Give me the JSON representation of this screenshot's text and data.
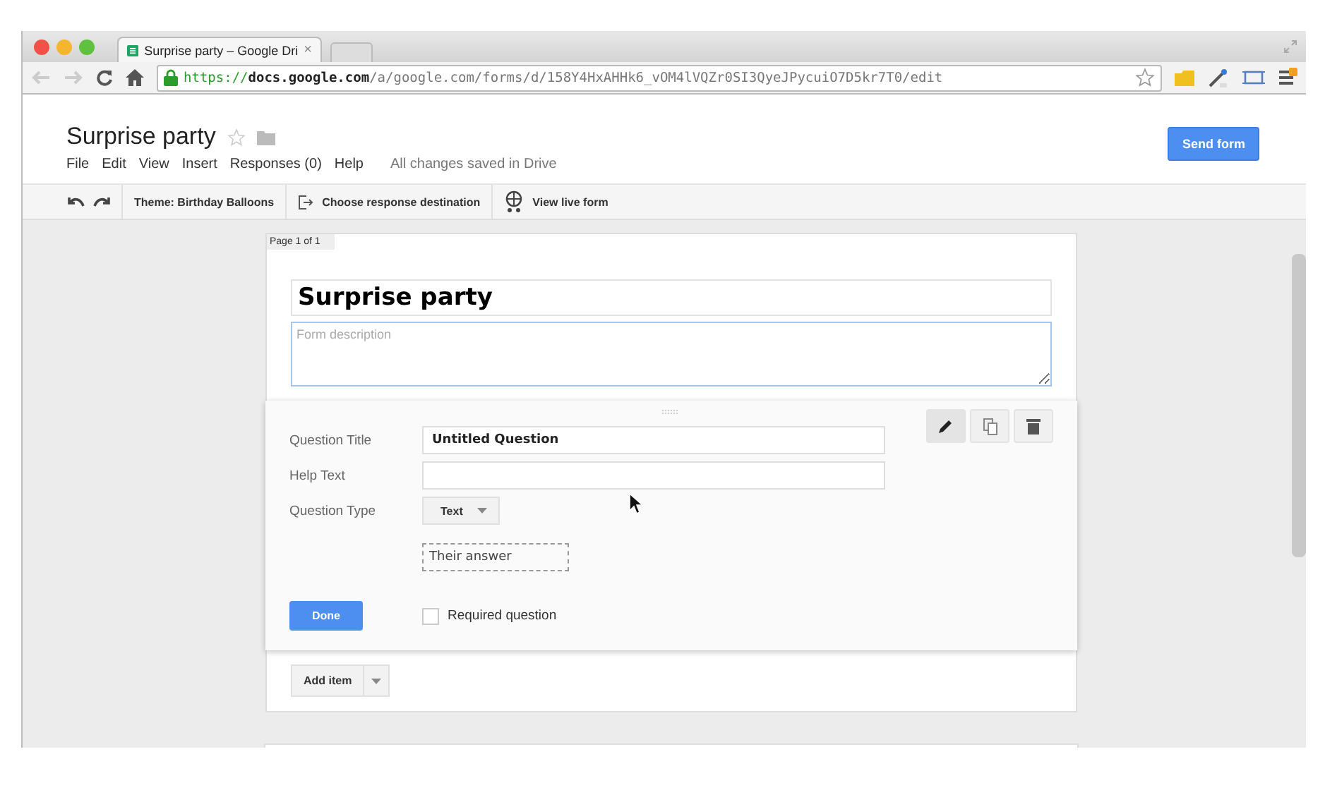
{
  "browser": {
    "tab": {
      "title": "Surprise party – Google Dri",
      "close": "×",
      "selected": true
    },
    "url": {
      "scheme": "https://",
      "host": "docs.google.com",
      "path": "/a/google.com/forms/d/158Y4HxAHHk6_vOM4lVQZr0SI3QyeJPycuiO7D5kr7T0/edit"
    }
  },
  "document": {
    "title": "Surprise party",
    "starred": false,
    "menu": [
      "File",
      "Edit",
      "View",
      "Insert",
      "Responses (0)",
      "Help"
    ],
    "save_status": "All changes saved in Drive",
    "send_button": "Send form"
  },
  "toolbar": {
    "theme": "Theme: Birthday Balloons",
    "destination": "Choose response destination",
    "live": "View live form"
  },
  "form": {
    "page_label": "Page 1 of 1",
    "title": "Surprise party",
    "description_placeholder": "Form description",
    "question": {
      "fields": [
        {
          "label": "Question Title",
          "value": "Untitled Question"
        },
        {
          "label": "Help Text"
        }
      ],
      "type_label": "Question Type",
      "type_value": "Text",
      "answer_preview": "Their answer",
      "done": "Done",
      "required": {
        "label": "Required question",
        "checked": false
      }
    },
    "add_item": "Add item"
  }
}
